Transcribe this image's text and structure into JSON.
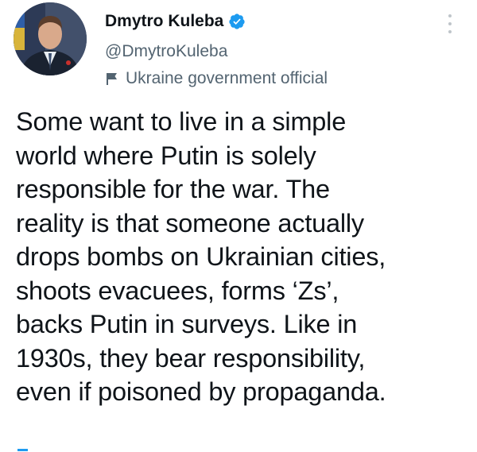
{
  "author": {
    "name": "Dmytro Kuleba",
    "handle": "@DmytroKuleba",
    "label": "Ukraine government official",
    "verified_color": "#1d9bf0"
  },
  "icons": {
    "verified": "verified-badge-icon",
    "label": "flag-icon",
    "menu": "more-options-icon"
  },
  "tweet": {
    "lines": [
      "Some want to live in a simple",
      "world where Putin is solely",
      "responsible for the war. The",
      "reality is that someone actually",
      "drops bombs on Ukrainian cities,",
      "shoots evacuees, forms ‘Zs’,",
      "backs Putin in surveys. Like in",
      "1930s, they bear responsibility,",
      "even if poisoned by propaganda."
    ]
  }
}
